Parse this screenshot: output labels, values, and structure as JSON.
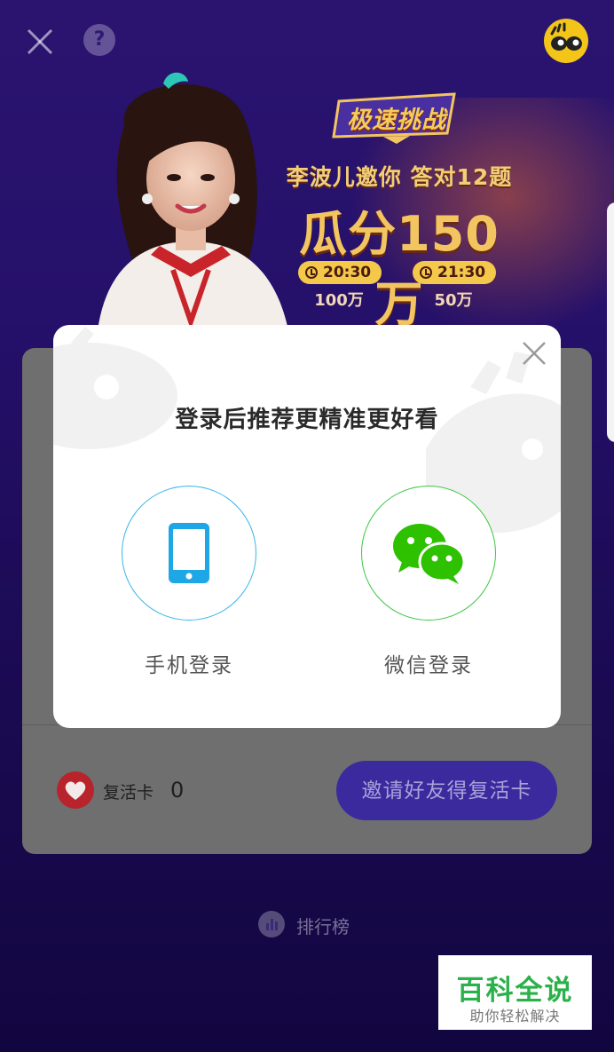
{
  "topbar": {
    "close_icon": "close-icon",
    "help_label": "?",
    "logo_icon": "eyes-logo-icon"
  },
  "banner": {
    "challenge_logo": "极速挑战",
    "invite_text": "李波儿邀你 答对12题",
    "prize_text": "瓜分150万",
    "sessions": [
      {
        "time": "20:30",
        "prize": "100万"
      },
      {
        "time": "21:30",
        "prize": "50万"
      }
    ]
  },
  "card": {
    "revive_label": "复活卡",
    "revive_count": "0",
    "invite_button": "邀请好友得复活卡"
  },
  "leaderboard": {
    "label": "排行榜"
  },
  "modal": {
    "title": "登录后推荐更精准更好看",
    "phone_login": "手机登录",
    "wechat_login": "微信登录"
  },
  "watermark": {
    "title": "百科全说",
    "subtitle": "助你轻松解决"
  },
  "colors": {
    "background_top": "#2a1470",
    "accent_gold": "#f3c560",
    "phone_blue": "#1ea7e6",
    "wechat_green": "#2dc100",
    "button_purple": "#3b2a9e"
  }
}
